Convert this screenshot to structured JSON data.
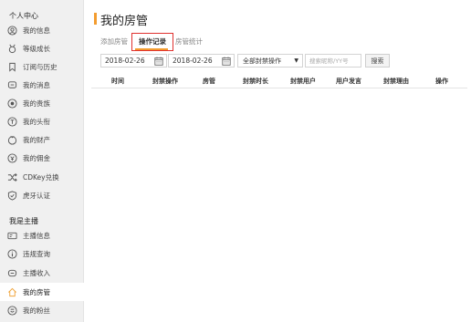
{
  "sidebar": {
    "section1_title": "个人中心",
    "section1_items": [
      {
        "label": "我的信息",
        "icon": "user-icon"
      },
      {
        "label": "等级成长",
        "icon": "medal-icon"
      },
      {
        "label": "订阅与历史",
        "icon": "bookmark-icon"
      },
      {
        "label": "我的消息",
        "icon": "message-icon"
      },
      {
        "label": "我的贵族",
        "icon": "crown-icon"
      },
      {
        "label": "我的头衔",
        "icon": "title-badge-icon"
      },
      {
        "label": "我的财产",
        "icon": "wallet-icon"
      },
      {
        "label": "我的佣金",
        "icon": "coin-icon"
      },
      {
        "label": "CDKey兑换",
        "icon": "shuffle-icon"
      },
      {
        "label": "虎牙认证",
        "icon": "shield-check-icon"
      }
    ],
    "section2_title": "我是主播",
    "section2_items": [
      {
        "label": "主播信息",
        "icon": "id-card-icon"
      },
      {
        "label": "违规查询",
        "icon": "info-icon"
      },
      {
        "label": "主播收入",
        "icon": "income-icon"
      },
      {
        "label": "我的房管",
        "icon": "home-icon",
        "active": true
      },
      {
        "label": "我的粉丝",
        "icon": "fan-badge-icon"
      }
    ],
    "active_color": "#f0a43a"
  },
  "main": {
    "title": "我的房管",
    "accent_color": "#f39c2f",
    "tabs": [
      {
        "label": "添加房管"
      },
      {
        "label": "操作记录",
        "active": true
      },
      {
        "label": "房管统计"
      }
    ],
    "filters": {
      "start_date": "2018-02-26",
      "end_date": "2018-02-26",
      "action_select": "全部封禁操作",
      "search_placeholder": "搜索昵称/YY号",
      "search_button": "搜索"
    },
    "table": {
      "columns": [
        "时间",
        "封禁操作",
        "房管",
        "封禁时长",
        "封禁用户",
        "用户发言",
        "封禁理由",
        "操作"
      ]
    }
  }
}
